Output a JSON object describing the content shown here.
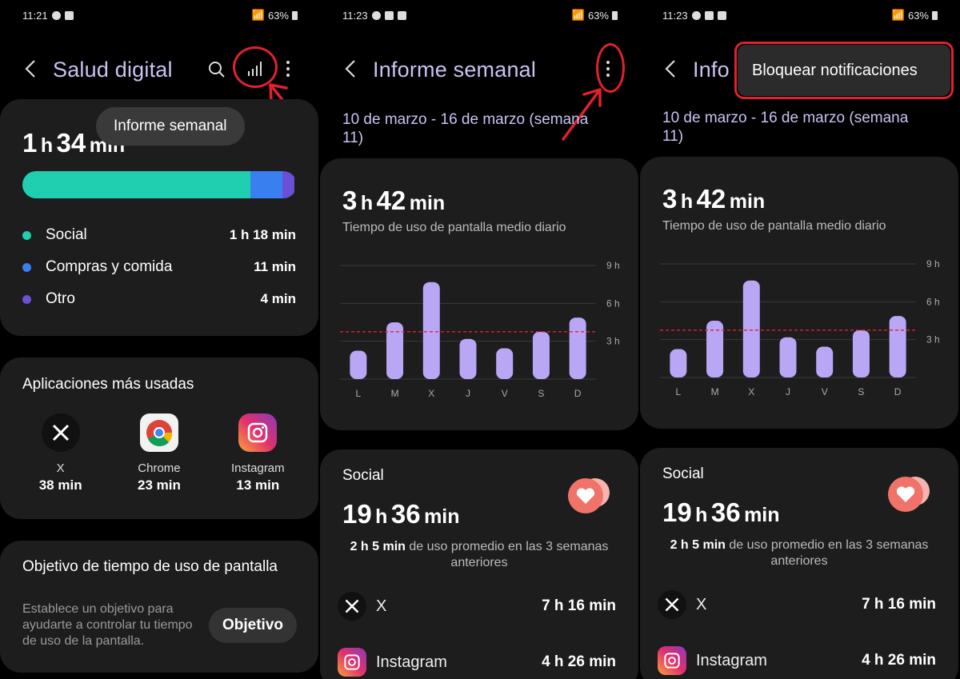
{
  "status": [
    {
      "time": "11:21",
      "battery": "63%"
    },
    {
      "time": "11:23",
      "battery": "63%"
    },
    {
      "time": "11:23",
      "battery": "63%"
    }
  ],
  "screen1": {
    "title": "Salud digital",
    "tooltip": "Informe semanal",
    "total": {
      "hours": "1",
      "h": "h",
      "minutes": "34",
      "min": "min"
    },
    "usage_fractions": {
      "social": 0.83,
      "compras": 0.117,
      "otro": 0.043
    },
    "categories": [
      {
        "name": "Social",
        "value": "1 h 18 min",
        "color": "#1fcfb0"
      },
      {
        "name": "Compras y comida",
        "value": "11 min",
        "color": "#3a7ff0"
      },
      {
        "name": "Otro",
        "value": "4 min",
        "color": "#6b4fd6"
      }
    ],
    "apps_title": "Aplicaciones más usadas",
    "apps": [
      {
        "name": "X",
        "time": "38 min",
        "icon": "x-logo-icon"
      },
      {
        "name": "Chrome",
        "time": "23 min",
        "icon": "chrome-logo-icon"
      },
      {
        "name": "Instagram",
        "time": "13 min",
        "icon": "instagram-logo-icon"
      }
    ],
    "goal_title": "Objetivo de tiempo de uso de pantalla",
    "goal_desc": "Establece un objetivo para ayudarte a controlar tu tiempo de uso de la pantalla.",
    "goal_button": "Objetivo"
  },
  "weekly": {
    "title": "Informe semanal",
    "title_short": "Info",
    "range": "10 de marzo - 16 de marzo (semana 11)",
    "avg": {
      "hours": "3",
      "h": "h",
      "minutes": "42",
      "min": "min"
    },
    "avg_label": "Tiempo de uso de pantalla medio diario",
    "social_label": "Social",
    "social_total": {
      "hours": "19",
      "h": "h",
      "minutes": "36",
      "min": "min"
    },
    "social_prev_bold": "2 h 5 min",
    "social_prev_rest": "de uso promedio en las 3 semanas anteriores",
    "apps": [
      {
        "name": "X",
        "time": "7 h 16 min",
        "icon": "x-logo-icon"
      },
      {
        "name": "Instagram",
        "time": "4 h 26 min",
        "icon": "instagram-logo-icon"
      }
    ],
    "menu_item": "Bloquear notificaciones"
  },
  "chart_data": {
    "type": "bar",
    "categories": [
      "L",
      "M",
      "X",
      "J",
      "V",
      "S",
      "D"
    ],
    "values": [
      1.2,
      2.4,
      4.1,
      1.7,
      1.3,
      2.0,
      2.6
    ],
    "yticks": [
      "3 h",
      "6 h",
      "9 h"
    ],
    "ylim": [
      0,
      4.8
    ],
    "average_line": 2.0,
    "bar_color": "#b9a6f4",
    "avg_line_color": "#e0213a"
  }
}
